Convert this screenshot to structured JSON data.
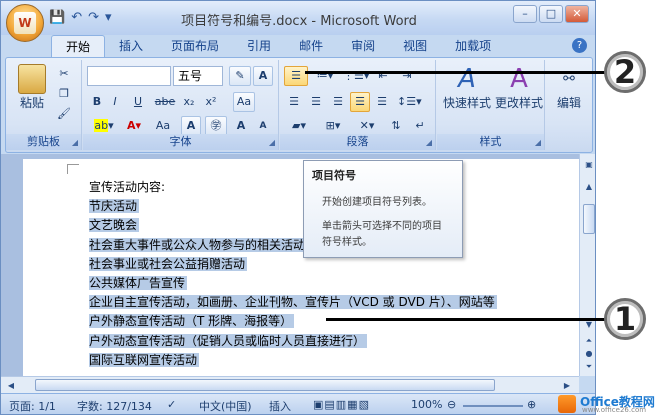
{
  "window": {
    "title": "项目符号和编号.docx - Microsoft Word",
    "controls": [
      "–",
      "□",
      "✕"
    ]
  },
  "quick_access": [
    "💾",
    "↶",
    "↷",
    "▾"
  ],
  "tabs": [
    {
      "label": "开始",
      "active": true
    },
    {
      "label": "插入"
    },
    {
      "label": "页面布局"
    },
    {
      "label": "引用"
    },
    {
      "label": "邮件"
    },
    {
      "label": "审阅"
    },
    {
      "label": "视图"
    },
    {
      "label": "加载项"
    }
  ],
  "help_icon": "?",
  "ribbon": {
    "clipboard": {
      "label": "剪贴板",
      "paste": "粘贴"
    },
    "font": {
      "label": "字体",
      "font_name": "",
      "font_size": "五号",
      "bold": "B",
      "italic": "I",
      "underline": "U",
      "strike": "abe",
      "subscript": "x₂",
      "superscript": "x²",
      "change_case": "Aa",
      "grow": "A",
      "shrink": "A"
    },
    "paragraph": {
      "label": "段落"
    },
    "styles": {
      "label": "样式",
      "quick_styles": "快速样式",
      "change_styles": "更改样式"
    },
    "editing": {
      "label": "编辑"
    }
  },
  "tooltip": {
    "title": "项目符号",
    "line1": "开始创建项目符号列表。",
    "line2": "单击箭头可选择不同的项目",
    "line3": "符号样式。"
  },
  "document": {
    "lines": [
      "宣传活动内容:",
      "节庆活动",
      "文艺晚会",
      "社会重大事件或公众人物参与的相关活动",
      "社会事业或社会公益捐赠活动",
      "公共媒体广告宣传",
      "企业自主宣传活动，如画册、企业刊物、宣传片（VCD 或 DVD 片）、网站等",
      "户外静态宣传活动（T 形牌、海报等）",
      "户外动态宣传活动（促销人员或临时人员直接进行）",
      "国际互联网宣传活动"
    ]
  },
  "status_bar": {
    "page": "页面: 1/1",
    "words": "字数: 127/134",
    "language": "中文(中国)",
    "insert": "插入",
    "zoom": "100%"
  },
  "callouts": {
    "one": "1",
    "two": "2"
  },
  "watermark": {
    "site": "Office教程网",
    "url": "www.office26.com"
  },
  "colors": {
    "ribbon_bg": "#d8e4f5",
    "selection": "#b6cbe6",
    "accent": "#15428b"
  }
}
